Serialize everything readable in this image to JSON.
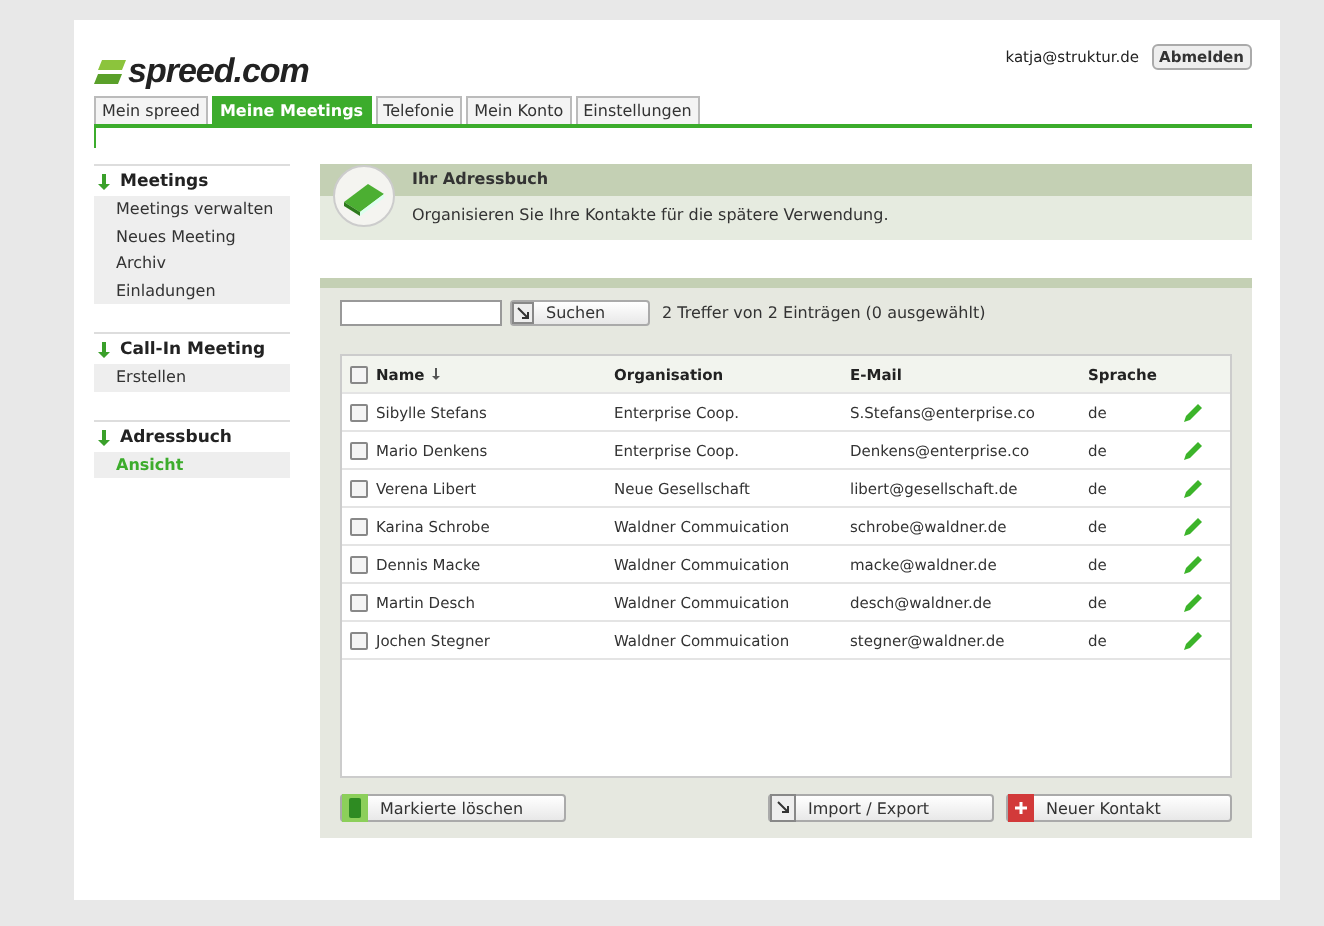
{
  "logo": "spreed.com",
  "user": {
    "email": "katja@struktur.de",
    "logout": "Abmelden"
  },
  "tabs": [
    {
      "label": "Mein spreed",
      "selected": false
    },
    {
      "label": "Meine Meetings",
      "selected": true
    },
    {
      "label": "Telefonie",
      "selected": false
    },
    {
      "label": "Mein Konto",
      "selected": false
    },
    {
      "label": "Einstellungen",
      "selected": false
    }
  ],
  "sidebar": [
    {
      "title": "Meetings",
      "items": [
        {
          "label": "Meetings verwalten",
          "selected": false
        },
        {
          "label": "Neues Meeting",
          "selected": false
        },
        {
          "label": "Archiv",
          "selected": false
        },
        {
          "label": "Einladungen",
          "selected": false
        }
      ]
    },
    {
      "title": "Call-In Meeting",
      "items": [
        {
          "label": "Erstellen",
          "selected": false
        }
      ]
    },
    {
      "title": "Adressbuch",
      "items": [
        {
          "label": "Ansicht",
          "selected": true
        }
      ]
    }
  ],
  "header": {
    "title": "Ihr Adressbuch",
    "subtitle": "Organisieren Sie Ihre Kontakte für die spätere Verwendung."
  },
  "search": {
    "button": "Suchen",
    "result": "2 Treffer von 2 Einträgen (0 ausgewählt)"
  },
  "table": {
    "all_checked": false,
    "columns": [
      "Name",
      "Organisation",
      "E-Mail",
      "Sprache"
    ],
    "rows": [
      {
        "name": "Sibylle Stefans",
        "org": "Enterprise Coop.",
        "email": "S.Stefans@enterprise.co",
        "lang": "de",
        "checked": false
      },
      {
        "name": "Mario Denkens",
        "org": "Enterprise Coop.",
        "email": "Denkens@enterprise.co",
        "lang": "de",
        "checked": false
      },
      {
        "name": "Verena Libert",
        "org": "Neue Gesellschaft",
        "email": "libert@gesellschaft.de",
        "lang": "de",
        "checked": false
      },
      {
        "name": "Karina Schrobe",
        "org": "Waldner Commuication",
        "email": "schrobe@waldner.de",
        "lang": "de",
        "checked": false
      },
      {
        "name": "Dennis Macke",
        "org": "Waldner Commuication",
        "email": "macke@waldner.de",
        "lang": "de",
        "checked": false
      },
      {
        "name": "Martin Desch",
        "org": "Waldner Commuication",
        "email": "desch@waldner.de",
        "lang": "de",
        "checked": false
      },
      {
        "name": "Jochen Stegner",
        "org": "Waldner Commuication",
        "email": "stegner@waldner.de",
        "lang": "de",
        "checked": false
      }
    ]
  },
  "buttons": [
    {
      "kind": "delete",
      "label": "Markierte löschen"
    },
    {
      "kind": "import",
      "label": "Import / Export"
    },
    {
      "kind": "add",
      "label": "Neuer Kontakt"
    }
  ]
}
